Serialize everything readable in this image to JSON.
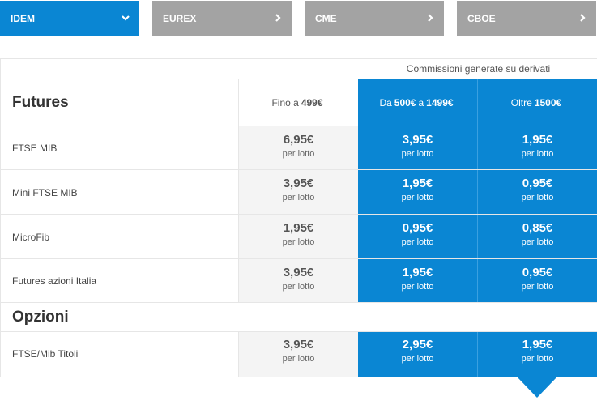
{
  "tabs": [
    {
      "label": "IDEM",
      "icon": "chevron-down-icon",
      "active": true
    },
    {
      "label": "EUREX",
      "icon": "chevron-right-icon",
      "active": false
    },
    {
      "label": "CME",
      "icon": "chevron-right-icon",
      "active": false
    },
    {
      "label": "CBOE",
      "icon": "chevron-right-icon",
      "active": false
    }
  ],
  "header_caption": "Commissioni generate su derivati",
  "futures": {
    "title": "Futures",
    "col1": {
      "pre": "Fino a",
      "bold": "499€"
    },
    "col2": {
      "pre": "Da",
      "bold1": "500€",
      "mid": "a",
      "bold2": "1499€"
    },
    "col3": {
      "pre": "Oltre",
      "bold": "1500€"
    },
    "rows": [
      {
        "label": "FTSE MIB",
        "p1": "6,95€",
        "p2": "3,95€",
        "p3": "1,95€"
      },
      {
        "label": "Mini FTSE MIB",
        "p1": "3,95€",
        "p2": "1,95€",
        "p3": "0,95€"
      },
      {
        "label": "MicroFib",
        "p1": "1,95€",
        "p2": "0,95€",
        "p3": "0,85€"
      },
      {
        "label": "Futures azioni Italia",
        "p1": "3,95€",
        "p2": "1,95€",
        "p3": "0,95€"
      }
    ]
  },
  "opzioni": {
    "title": "Opzioni",
    "rows": [
      {
        "label": "FTSE/Mib Titoli",
        "p1": "3,95€",
        "p2": "2,95€",
        "p3": "1,95€"
      }
    ]
  },
  "unit_label": "per lotto",
  "colors": {
    "accent": "#0a86d3",
    "tab_inactive": "#a3a3a3",
    "cell_grey": "#f4f4f4"
  }
}
